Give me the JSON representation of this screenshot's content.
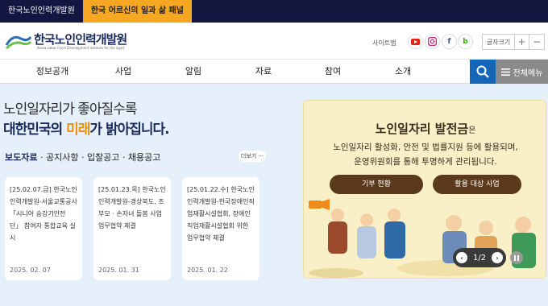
{
  "topbar": {
    "tab1": "한국노인인력개발원",
    "tab2": "한국 어르신의 일과 삶 패널"
  },
  "header": {
    "logo_name": "한국노인인력개발원",
    "logo_sub": "Korea Labor Force Development Institute for the aged",
    "sitemap": "사이트맵",
    "social": {
      "facebook": "f",
      "blog": "b"
    },
    "font_size_label": "글자크기",
    "font_plus": "+",
    "font_minus": "−"
  },
  "nav": {
    "items": [
      "정보공개",
      "사업",
      "알림",
      "자료",
      "참여",
      "소개"
    ],
    "all_menu": "전체메뉴"
  },
  "hero": {
    "line1": "노인일자리가 좋아질수록",
    "line2_a": "대한민국의 ",
    "line2_hl": "미래",
    "line2_b": "가 밝아집니다."
  },
  "news": {
    "section_a": "보도자료",
    "section_b": " · 공지사항 · 입찰공고 · 채용공고",
    "more": "더보기 ···",
    "cards": [
      {
        "title": "[25.02.07.금] 한국노인인력개발원-서울교통공사 「시니어 승강기안전단」 참여자 통합교육 실시",
        "date": "2025. 02. 07"
      },
      {
        "title": "[25.01.23.목] 한국노인인력개발원-경상북도, 조부모 · 손자녀 돌봄 사업 업무협약 체결",
        "date": "2025. 01. 31"
      },
      {
        "title": "[25.01.22.수] 한국노인인력개발원-한국장애인직업재활시설협회, 장애인직업재활시설협회 위한 업무협약 체결",
        "date": "2025. 01. 22"
      }
    ]
  },
  "banner": {
    "title": "노인일자리 발전금",
    "title_suffix": "은",
    "desc1": "노인일자리 활성화, 안전 및 법률지원 등에 활용되며,",
    "desc2": "운영위원회를 통해 투명하게 관리됩니다.",
    "btn1": "기부 현황",
    "btn2": "활용 대상 사업",
    "pager": "1/2"
  }
}
